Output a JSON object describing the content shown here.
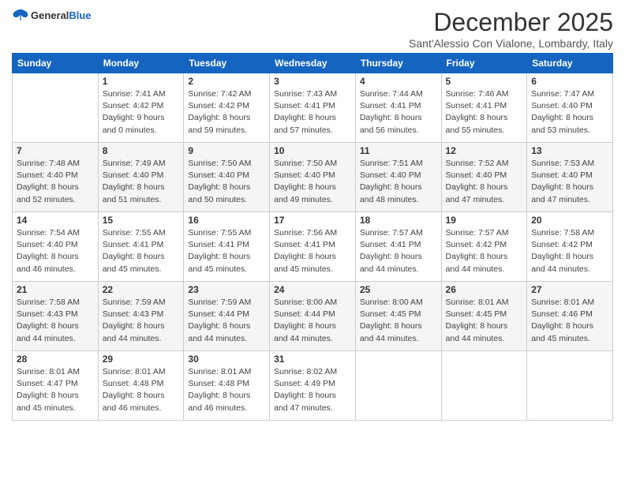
{
  "logo": {
    "general": "General",
    "blue": "Blue"
  },
  "title": "December 2025",
  "subtitle": "Sant'Alessio Con Vialone, Lombardy, Italy",
  "days_of_week": [
    "Sunday",
    "Monday",
    "Tuesday",
    "Wednesday",
    "Thursday",
    "Friday",
    "Saturday"
  ],
  "weeks": [
    [
      {
        "day": "",
        "info": ""
      },
      {
        "day": "1",
        "info": "Sunrise: 7:41 AM\nSunset: 4:42 PM\nDaylight: 9 hours\nand 0 minutes."
      },
      {
        "day": "2",
        "info": "Sunrise: 7:42 AM\nSunset: 4:42 PM\nDaylight: 8 hours\nand 59 minutes."
      },
      {
        "day": "3",
        "info": "Sunrise: 7:43 AM\nSunset: 4:41 PM\nDaylight: 8 hours\nand 57 minutes."
      },
      {
        "day": "4",
        "info": "Sunrise: 7:44 AM\nSunset: 4:41 PM\nDaylight: 8 hours\nand 56 minutes."
      },
      {
        "day": "5",
        "info": "Sunrise: 7:46 AM\nSunset: 4:41 PM\nDaylight: 8 hours\nand 55 minutes."
      },
      {
        "day": "6",
        "info": "Sunrise: 7:47 AM\nSunset: 4:40 PM\nDaylight: 8 hours\nand 53 minutes."
      }
    ],
    [
      {
        "day": "7",
        "info": "Sunrise: 7:48 AM\nSunset: 4:40 PM\nDaylight: 8 hours\nand 52 minutes."
      },
      {
        "day": "8",
        "info": "Sunrise: 7:49 AM\nSunset: 4:40 PM\nDaylight: 8 hours\nand 51 minutes."
      },
      {
        "day": "9",
        "info": "Sunrise: 7:50 AM\nSunset: 4:40 PM\nDaylight: 8 hours\nand 50 minutes."
      },
      {
        "day": "10",
        "info": "Sunrise: 7:50 AM\nSunset: 4:40 PM\nDaylight: 8 hours\nand 49 minutes."
      },
      {
        "day": "11",
        "info": "Sunrise: 7:51 AM\nSunset: 4:40 PM\nDaylight: 8 hours\nand 48 minutes."
      },
      {
        "day": "12",
        "info": "Sunrise: 7:52 AM\nSunset: 4:40 PM\nDaylight: 8 hours\nand 47 minutes."
      },
      {
        "day": "13",
        "info": "Sunrise: 7:53 AM\nSunset: 4:40 PM\nDaylight: 8 hours\nand 47 minutes."
      }
    ],
    [
      {
        "day": "14",
        "info": "Sunrise: 7:54 AM\nSunset: 4:40 PM\nDaylight: 8 hours\nand 46 minutes."
      },
      {
        "day": "15",
        "info": "Sunrise: 7:55 AM\nSunset: 4:41 PM\nDaylight: 8 hours\nand 45 minutes."
      },
      {
        "day": "16",
        "info": "Sunrise: 7:55 AM\nSunset: 4:41 PM\nDaylight: 8 hours\nand 45 minutes."
      },
      {
        "day": "17",
        "info": "Sunrise: 7:56 AM\nSunset: 4:41 PM\nDaylight: 8 hours\nand 45 minutes."
      },
      {
        "day": "18",
        "info": "Sunrise: 7:57 AM\nSunset: 4:41 PM\nDaylight: 8 hours\nand 44 minutes."
      },
      {
        "day": "19",
        "info": "Sunrise: 7:57 AM\nSunset: 4:42 PM\nDaylight: 8 hours\nand 44 minutes."
      },
      {
        "day": "20",
        "info": "Sunrise: 7:58 AM\nSunset: 4:42 PM\nDaylight: 8 hours\nand 44 minutes."
      }
    ],
    [
      {
        "day": "21",
        "info": "Sunrise: 7:58 AM\nSunset: 4:43 PM\nDaylight: 8 hours\nand 44 minutes."
      },
      {
        "day": "22",
        "info": "Sunrise: 7:59 AM\nSunset: 4:43 PM\nDaylight: 8 hours\nand 44 minutes."
      },
      {
        "day": "23",
        "info": "Sunrise: 7:59 AM\nSunset: 4:44 PM\nDaylight: 8 hours\nand 44 minutes."
      },
      {
        "day": "24",
        "info": "Sunrise: 8:00 AM\nSunset: 4:44 PM\nDaylight: 8 hours\nand 44 minutes."
      },
      {
        "day": "25",
        "info": "Sunrise: 8:00 AM\nSunset: 4:45 PM\nDaylight: 8 hours\nand 44 minutes."
      },
      {
        "day": "26",
        "info": "Sunrise: 8:01 AM\nSunset: 4:45 PM\nDaylight: 8 hours\nand 44 minutes."
      },
      {
        "day": "27",
        "info": "Sunrise: 8:01 AM\nSunset: 4:46 PM\nDaylight: 8 hours\nand 45 minutes."
      }
    ],
    [
      {
        "day": "28",
        "info": "Sunrise: 8:01 AM\nSunset: 4:47 PM\nDaylight: 8 hours\nand 45 minutes."
      },
      {
        "day": "29",
        "info": "Sunrise: 8:01 AM\nSunset: 4:48 PM\nDaylight: 8 hours\nand 46 minutes."
      },
      {
        "day": "30",
        "info": "Sunrise: 8:01 AM\nSunset: 4:48 PM\nDaylight: 8 hours\nand 46 minutes."
      },
      {
        "day": "31",
        "info": "Sunrise: 8:02 AM\nSunset: 4:49 PM\nDaylight: 8 hours\nand 47 minutes."
      },
      {
        "day": "",
        "info": ""
      },
      {
        "day": "",
        "info": ""
      },
      {
        "day": "",
        "info": ""
      }
    ]
  ]
}
